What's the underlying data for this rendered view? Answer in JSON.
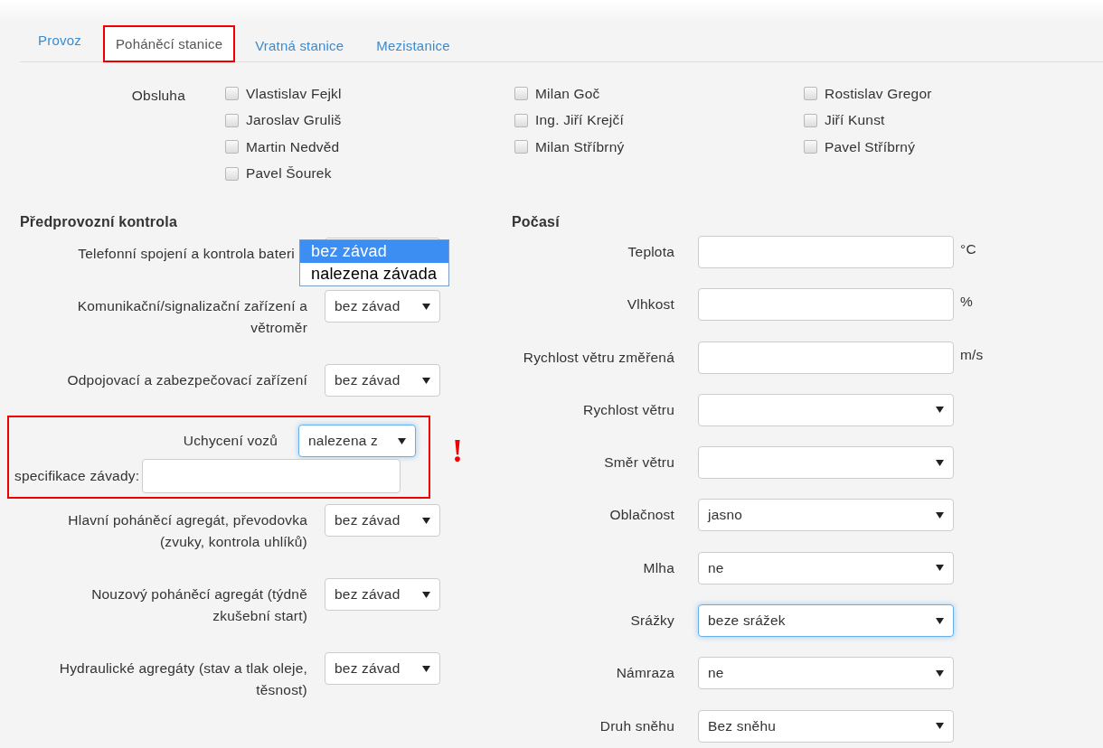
{
  "tabs": [
    {
      "label": "Provoz",
      "selected": false
    },
    {
      "label": "Poháněcí stanice",
      "selected": true
    },
    {
      "label": "Vratná stanice",
      "selected": false
    },
    {
      "label": "Mezistanice",
      "selected": false
    }
  ],
  "crew": {
    "label": "Obsluha",
    "columns": [
      [
        {
          "name": "Vlastislav Fejkl",
          "checked": false
        },
        {
          "name": "Jaroslav Gruliš",
          "checked": false
        },
        {
          "name": "Martin Nedvěd",
          "checked": false
        },
        {
          "name": "Pavel Šourek",
          "checked": false
        }
      ],
      [
        {
          "name": "Milan Goč",
          "checked": false
        },
        {
          "name": "Ing. Jiří Krejčí",
          "checked": false
        },
        {
          "name": "Milan Stříbrný",
          "checked": false
        }
      ],
      [
        {
          "name": "Rostislav Gregor",
          "checked": false
        },
        {
          "name": "Jiří Kunst",
          "checked": false
        },
        {
          "name": "Pavel Stříbrný",
          "checked": false
        }
      ]
    ]
  },
  "pre_check": {
    "title": "Předprovozní kontrola",
    "rows": [
      {
        "kind": "open_select",
        "label": "Telefonní spojení a kontrola bateri",
        "options": [
          {
            "label": "bez závad",
            "selected": true
          },
          {
            "label": "nalezena závada",
            "selected": false
          }
        ]
      },
      {
        "kind": "select",
        "label": "Komunikační/signalizační zařízení a větroměr",
        "value": "bez závad",
        "focused": false
      },
      {
        "kind": "select",
        "label": "Odpojovací a zabezpečovací zařízení",
        "value": "bez závad",
        "focused": false
      },
      {
        "kind": "fault",
        "label": "Uchycení vozů",
        "value": "nalezena z",
        "focused": true,
        "detail_label": "specifikace závady:",
        "alert": "!"
      },
      {
        "kind": "select",
        "label": "Hlavní poháněcí agregát, převodovka (zvuky, kontrola uhlíků)",
        "value": "bez závad",
        "focused": false
      },
      {
        "kind": "select",
        "label": "Nouzový poháněcí agregát (týdně zkušební start)",
        "value": "bez závad",
        "focused": false
      },
      {
        "kind": "select",
        "label": "Hydraulické agregáty (stav a tlak oleje, těsnost)",
        "value": "bez závad",
        "focused": false
      }
    ]
  },
  "weather": {
    "title": "Počasí",
    "rows": [
      {
        "kind": "input",
        "label": "Teplota",
        "unit": "°C"
      },
      {
        "kind": "input",
        "label": "Vlhkost",
        "unit": "%"
      },
      {
        "kind": "input",
        "label": "Rychlost větru změřená",
        "unit": "m/s"
      },
      {
        "kind": "select",
        "label": "Rychlost větru",
        "focused": false
      },
      {
        "kind": "select",
        "label": "Směr větru",
        "focused": false
      },
      {
        "kind": "select",
        "label": "Oblačnost",
        "value": "jasno",
        "focused": false
      },
      {
        "kind": "select",
        "label": "Mlha",
        "value": "ne",
        "focused": false
      },
      {
        "kind": "select",
        "label": "Srážky",
        "value": "beze srážek",
        "focused": true
      },
      {
        "kind": "select",
        "label": "Námraza",
        "value": "ne",
        "focused": false
      },
      {
        "kind": "select",
        "label": "Druh sněhu",
        "value": "Bez sněhu",
        "focused": false
      }
    ]
  }
}
